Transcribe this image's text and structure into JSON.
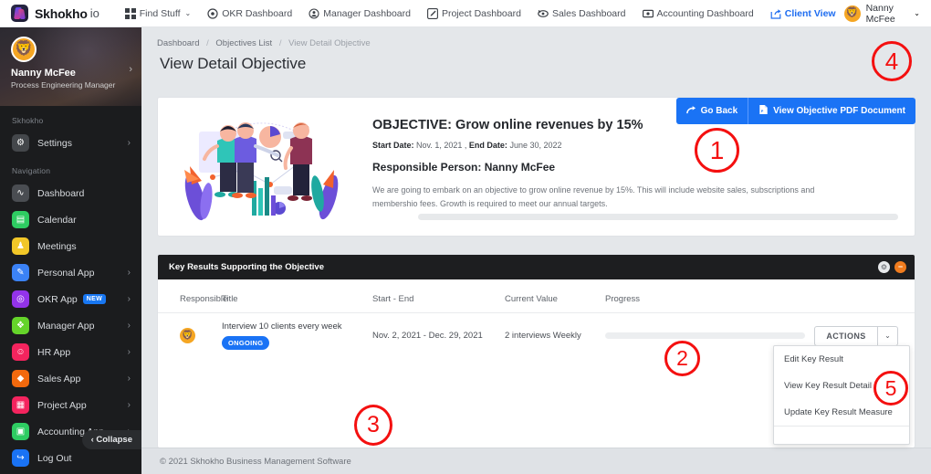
{
  "topbar": {
    "brand": {
      "name": "Skhokho",
      "suffix": "io",
      "logo_icon": "skhokho-logo-icon"
    },
    "nav": [
      {
        "label": "Find Stuff",
        "icon": "grid-icon",
        "caret": "⌄",
        "active": false
      },
      {
        "label": "OKR Dashboard",
        "icon": "target-icon",
        "active": false
      },
      {
        "label": "Manager Dashboard",
        "icon": "person-circle-icon",
        "active": false
      },
      {
        "label": "Project Dashboard",
        "icon": "pencil-square-icon",
        "active": false
      },
      {
        "label": "Sales Dashboard",
        "icon": "money-icon",
        "active": false
      },
      {
        "label": "Accounting Dashboard",
        "icon": "banknote-icon",
        "active": false
      },
      {
        "label": "Client View",
        "icon": "share-square-icon",
        "active": true
      }
    ],
    "user": {
      "name": "Nanny McFee",
      "caret": "⌄",
      "avatar_icon": "lion-avatar"
    }
  },
  "sidebar": {
    "profile": {
      "name": "Nanny McFee",
      "role": "Process Engineering Manager",
      "chevron": "›",
      "avatar_icon": "lion-avatar"
    },
    "sections": [
      {
        "label": "Skhokho",
        "items": [
          {
            "label": "Settings",
            "icon": "gear-icon",
            "glyph": "⚙",
            "color": "#44474b",
            "chevron": "›"
          }
        ]
      },
      {
        "label": "Navigation",
        "items": [
          {
            "label": "Dashboard",
            "icon": "pulse-icon",
            "glyph": "∿",
            "color": "#4a4d52",
            "chevron": ""
          },
          {
            "label": "Calendar",
            "icon": "calendar-icon",
            "glyph": "▤",
            "color": "#2ecc62",
            "chevron": ""
          },
          {
            "label": "Meetings",
            "icon": "people-icon",
            "glyph": "♟",
            "color": "#f2c728",
            "chevron": ""
          },
          {
            "label": "Personal App",
            "icon": "pencil-icon",
            "glyph": "✎",
            "color": "#3b82f6",
            "chevron": "›"
          },
          {
            "label": "OKR App",
            "icon": "target-icon",
            "glyph": "◎",
            "color": "#9333ea",
            "chevron": "›",
            "badge": "NEW"
          },
          {
            "label": "Manager App",
            "icon": "box-icon",
            "glyph": "❖",
            "color": "#65d42a",
            "chevron": "›"
          },
          {
            "label": "HR App",
            "icon": "people-heart-icon",
            "glyph": "☺",
            "color": "#f4245e",
            "chevron": "›"
          },
          {
            "label": "Sales App",
            "icon": "tag-icon",
            "glyph": "◆",
            "color": "#f2690d",
            "chevron": "›"
          },
          {
            "label": "Project App",
            "icon": "book-icon",
            "glyph": "▦",
            "color": "#f4245e",
            "chevron": "›"
          },
          {
            "label": "Accounting App",
            "icon": "calculator-icon",
            "glyph": "▣",
            "color": "#2ecc62",
            "chevron": "›"
          },
          {
            "label": "Log Out",
            "icon": "logout-icon",
            "glyph": "↪",
            "color": "#1a73f5",
            "chevron": ""
          }
        ]
      }
    ],
    "collapse": {
      "label": "Collapse",
      "chevron": "‹"
    }
  },
  "main": {
    "breadcrumb": {
      "items": [
        "Dashboard",
        "Objectives List",
        "View Detail Objective"
      ],
      "separator": "/"
    },
    "page_title": "View Detail Objective",
    "header_buttons": [
      {
        "label": "Go Back",
        "icon": "arrow-redo-icon"
      },
      {
        "label": "View Objective PDF Document",
        "icon": "pdf-file-icon"
      }
    ],
    "objective": {
      "title": "OBJECTIVE: Grow online revenues by 15%",
      "start_label": "Start Date:",
      "start_value": "Nov. 1, 2021",
      "end_label": "End Date:",
      "end_value": "June 30, 2022",
      "responsible": "Responsible Person: Nanny McFee",
      "description": "We are going to embark on an objective to grow online revenue by 15%. This will include website sales, subscriptions and membershio fees. Growth is required to meet our annual targets.",
      "progress_percent": 0,
      "illustration_icon": "team-analytics-illustration"
    },
    "key_results": {
      "header_title": "Key Results Supporting the Objective",
      "header_buttons": [
        {
          "icon": "settings-circle-icon",
          "glyph": "⚙"
        },
        {
          "icon": "minimize-circle-icon",
          "glyph": "−"
        }
      ],
      "columns": [
        "Responsible",
        "Title",
        "Start - End",
        "Current Value",
        "Progress"
      ],
      "rows": [
        {
          "responsible_icon": "lion-avatar",
          "title": "Interview 10 clients every week",
          "status": "ONGOING",
          "dates": "Nov. 2, 2021 - Dec. 29, 2021",
          "current_value": "2 interviews Weekly",
          "progress_percent": 0,
          "actions_label": "ACTIONS",
          "actions_caret": "⌄"
        }
      ]
    },
    "dropdown": {
      "items": [
        "Edit Key Result",
        "View Key Result Detail",
        "Update Key Result Measure"
      ]
    },
    "footer": "© 2021 Skhokho Business Management Software"
  },
  "annotations": [
    {
      "id": 1,
      "label": "1"
    },
    {
      "id": 2,
      "label": "2"
    },
    {
      "id": 3,
      "label": "3"
    },
    {
      "id": 4,
      "label": "4"
    },
    {
      "id": 5,
      "label": "5"
    }
  ],
  "colors": {
    "accent_blue": "#1a73f5",
    "annotation_red": "#f41010",
    "dark_panel": "#1d1e20",
    "sidebar_bg": "#1b1c1e",
    "orange": "#f07c1e"
  }
}
